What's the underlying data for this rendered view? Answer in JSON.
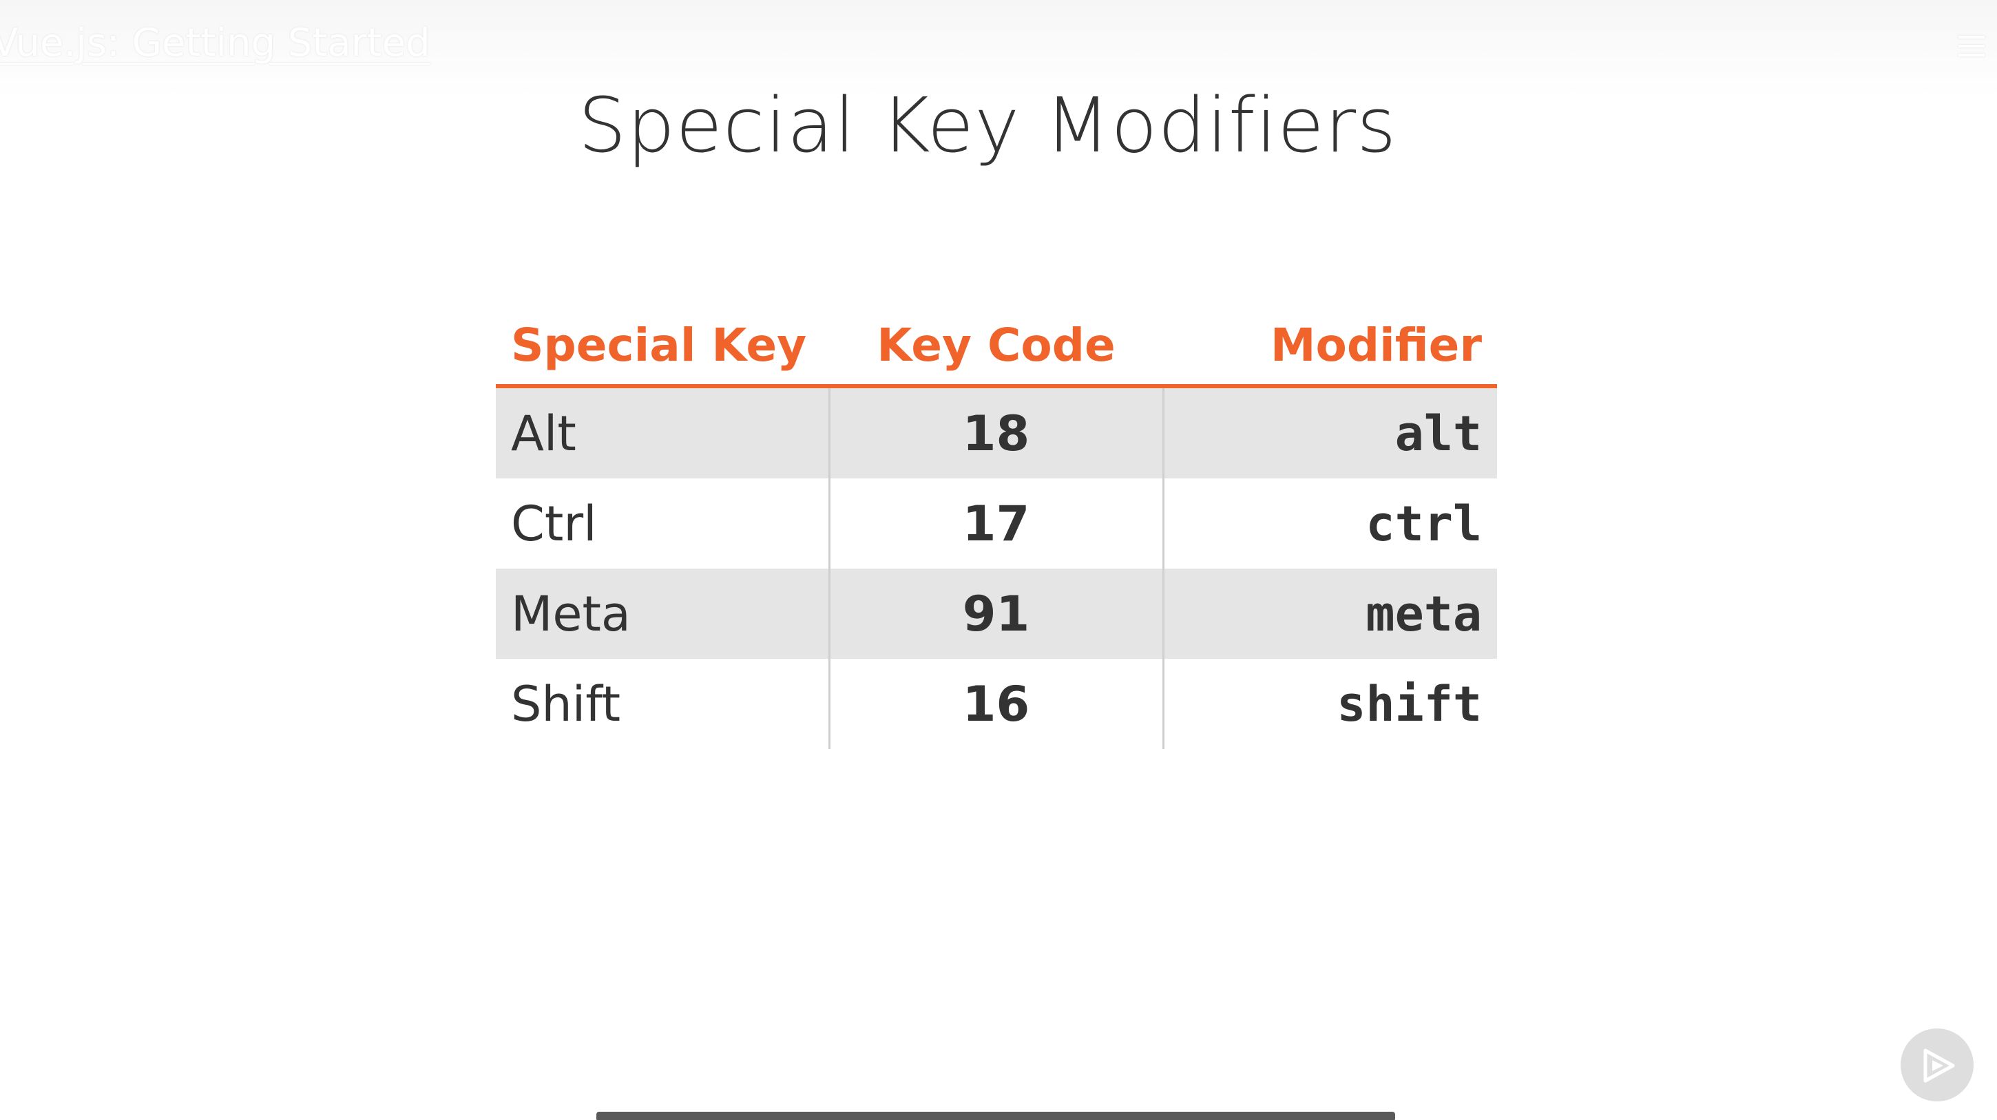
{
  "header": {
    "course_title": "Vue.js: Getting Started",
    "menu_icon": "hamburger-menu-icon"
  },
  "slide": {
    "title": "Special Key Modifiers",
    "table": {
      "headers": [
        "Special Key",
        "Key Code",
        "Modifier"
      ],
      "rows": [
        {
          "key": "Alt",
          "code": "18",
          "modifier": "alt"
        },
        {
          "key": "Ctrl",
          "code": "17",
          "modifier": "ctrl"
        },
        {
          "key": "Meta",
          "code": "91",
          "modifier": "meta"
        },
        {
          "key": "Shift",
          "code": "16",
          "modifier": "shift"
        }
      ]
    }
  },
  "player": {
    "play_icon": "play-icon"
  },
  "colors": {
    "accent": "#f0642b",
    "text": "#333333",
    "row_shade": "#e5e5e5"
  }
}
